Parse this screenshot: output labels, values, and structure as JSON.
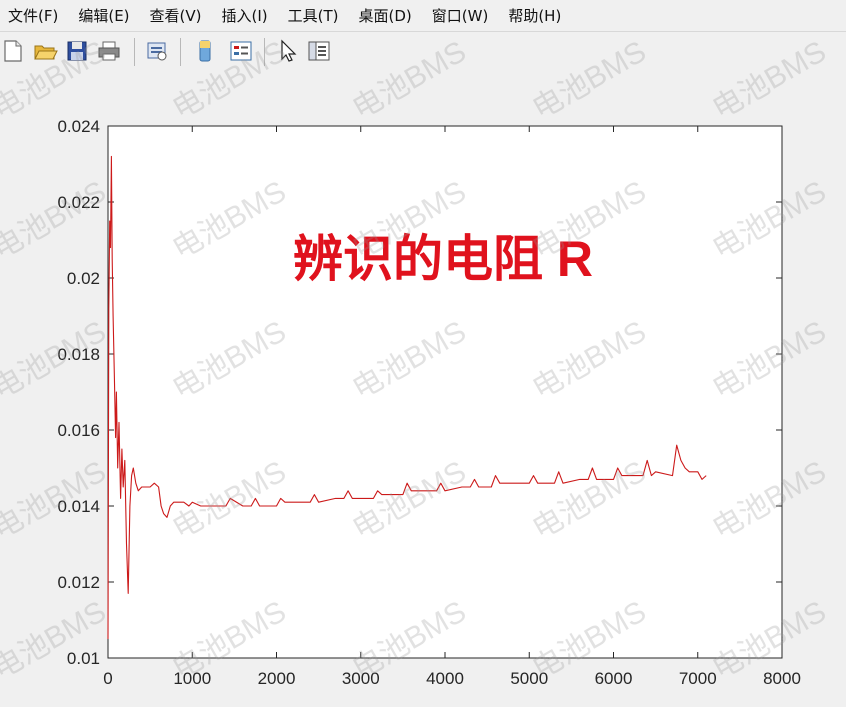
{
  "menu": [
    "文件(F)",
    "编辑(E)",
    "查看(V)",
    "插入(I)",
    "工具(T)",
    "桌面(D)",
    "窗口(W)",
    "帮助(H)"
  ],
  "toolbar_icons": [
    "new-file-icon",
    "open-folder-icon",
    "save-icon",
    "print-icon",
    "print-preview-icon",
    "colorbar-icon",
    "legend-icon",
    "pointer-icon",
    "property-editor-icon"
  ],
  "watermark": "电池BMS",
  "colors": {
    "line": "#cc1a1a",
    "annotation": "#e0121d"
  },
  "chart_data": {
    "type": "line",
    "title": "",
    "xlabel": "",
    "ylabel": "",
    "xlim": [
      0,
      8000
    ],
    "ylim": [
      0.01,
      0.024
    ],
    "xticks": [
      0,
      1000,
      2000,
      3000,
      4000,
      5000,
      6000,
      7000,
      8000
    ],
    "yticks": [
      0.01,
      0.012,
      0.014,
      0.016,
      0.018,
      0.02,
      0.022,
      0.024
    ],
    "xtick_labels": [
      "0",
      "1000",
      "2000",
      "3000",
      "4000",
      "5000",
      "6000",
      "7000",
      "8000"
    ],
    "ytick_labels": [
      "0.01",
      "0.012",
      "0.014",
      "0.016",
      "0.018",
      "0.02",
      "0.022",
      "0.024"
    ],
    "grid": false,
    "annotation": "辨识的电阻 R",
    "series": [
      {
        "x": [
          0,
          10,
          20,
          30,
          40,
          50,
          60,
          75,
          90,
          100,
          115,
          130,
          150,
          165,
          180,
          200,
          220,
          240,
          260,
          280,
          300,
          330,
          360,
          400,
          450,
          500,
          550,
          600,
          630,
          660,
          700,
          740,
          780,
          900,
          960,
          1000,
          1100,
          1300,
          1400,
          1450,
          1600,
          1700,
          1750,
          1800,
          2000,
          2050,
          2100,
          2300,
          2400,
          2450,
          2500,
          2700,
          2800,
          2850,
          2900,
          3000,
          3150,
          3200,
          3250,
          3500,
          3550,
          3600,
          3800,
          3900,
          3950,
          4000,
          4200,
          4300,
          4350,
          4400,
          4550,
          4600,
          4650,
          4800,
          5000,
          5050,
          5100,
          5300,
          5350,
          5400,
          5600,
          5700,
          5750,
          5800,
          6000,
          6050,
          6100,
          6350,
          6400,
          6450,
          6500,
          6700,
          6750,
          6800,
          6850,
          6900,
          7000,
          7050,
          7100
        ],
        "y": [
          0.0105,
          0.0192,
          0.0215,
          0.0208,
          0.0232,
          0.0205,
          0.019,
          0.0175,
          0.0158,
          0.017,
          0.015,
          0.0162,
          0.0142,
          0.0155,
          0.0145,
          0.0152,
          0.013,
          0.0117,
          0.014,
          0.0148,
          0.015,
          0.0146,
          0.0144,
          0.0145,
          0.0145,
          0.0145,
          0.0146,
          0.0145,
          0.014,
          0.0138,
          0.0137,
          0.014,
          0.0141,
          0.0141,
          0.014,
          0.0141,
          0.014,
          0.014,
          0.014,
          0.0142,
          0.014,
          0.014,
          0.0142,
          0.014,
          0.014,
          0.0142,
          0.0141,
          0.0141,
          0.0141,
          0.0143,
          0.0141,
          0.0142,
          0.0142,
          0.0144,
          0.0142,
          0.0142,
          0.0142,
          0.0144,
          0.0143,
          0.0143,
          0.0146,
          0.0144,
          0.0144,
          0.0144,
          0.0146,
          0.0144,
          0.0145,
          0.0145,
          0.0147,
          0.0145,
          0.0145,
          0.0148,
          0.0146,
          0.0146,
          0.0146,
          0.0148,
          0.0146,
          0.0146,
          0.0149,
          0.0146,
          0.0147,
          0.0147,
          0.015,
          0.0147,
          0.0147,
          0.015,
          0.0148,
          0.0148,
          0.0152,
          0.0148,
          0.0149,
          0.0148,
          0.0156,
          0.0152,
          0.015,
          0.0149,
          0.0149,
          0.0147,
          0.0148
        ]
      }
    ]
  }
}
